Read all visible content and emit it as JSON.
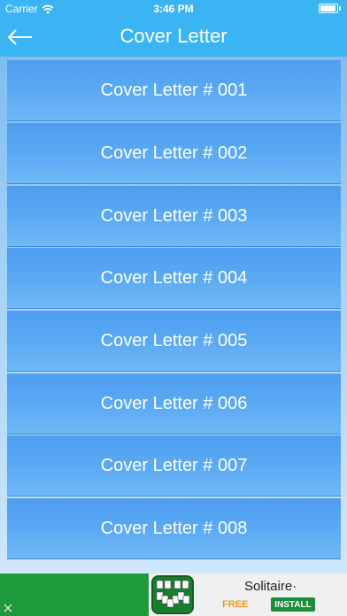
{
  "status_bar": {
    "carrier": "Carrier",
    "time": "3:46 PM"
  },
  "nav": {
    "title": "Cover Letter"
  },
  "list": {
    "items": [
      "Cover Letter # 001",
      "Cover Letter # 002",
      "Cover Letter # 003",
      "Cover Letter # 004",
      "Cover Letter # 005",
      "Cover Letter # 006",
      "Cover Letter # 007",
      "Cover Letter # 008"
    ]
  },
  "ad": {
    "app_name": "Solitaire·",
    "price": "FREE",
    "install_label": "INSTALL"
  }
}
